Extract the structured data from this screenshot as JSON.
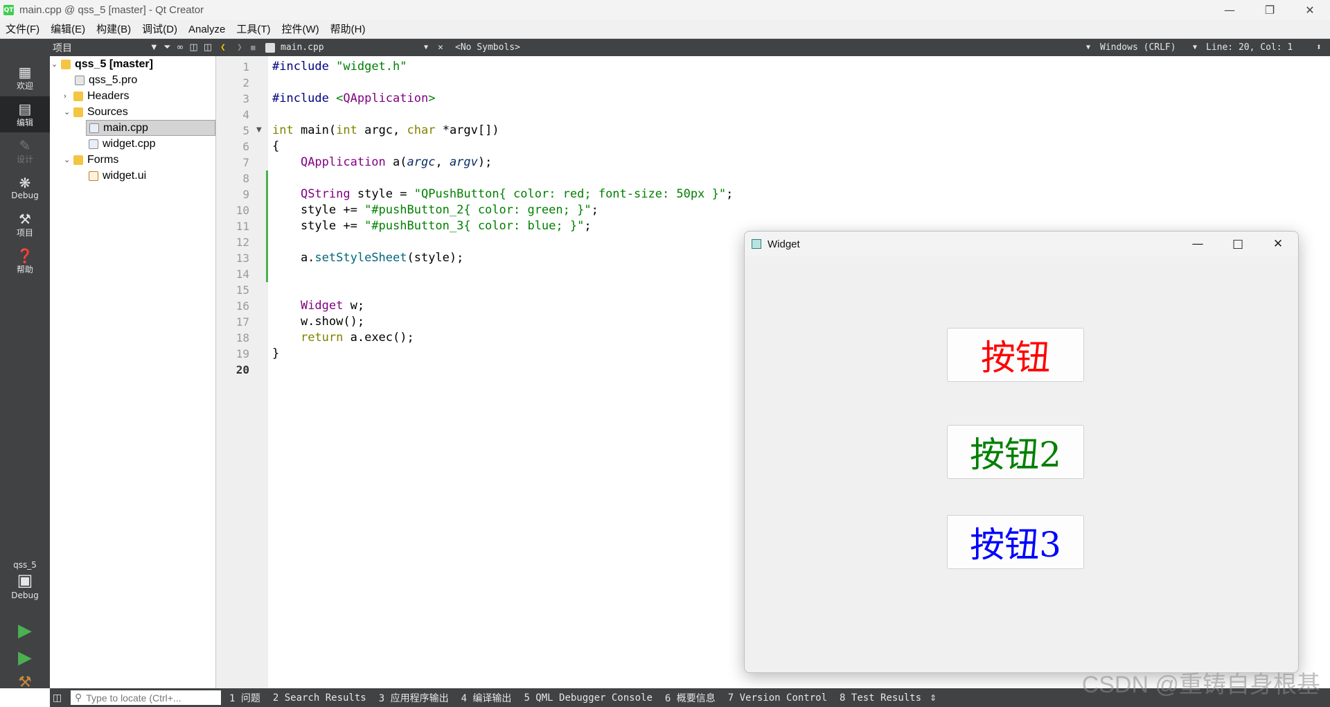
{
  "window": {
    "title": "main.cpp @ qss_5 [master] - Qt Creator",
    "app_icon": "QT"
  },
  "menu": [
    "文件(F)",
    "编辑(E)",
    "构建(B)",
    "调试(D)",
    "Analyze",
    "工具(T)",
    "控件(W)",
    "帮助(H)"
  ],
  "toolbar": {
    "project_label": "项目",
    "file_name": "main.cpp",
    "symbols": "<No Symbols>",
    "line_ending": "Windows (CRLF)",
    "position": "Line: 20, Col: 1"
  },
  "modes": [
    {
      "label": "欢迎",
      "icon": "grid-icon"
    },
    {
      "label": "编辑",
      "icon": "edit-icon",
      "active": true
    },
    {
      "label": "设计",
      "icon": "design-icon",
      "disabled": true
    },
    {
      "label": "Debug",
      "icon": "bug-icon"
    },
    {
      "label": "项目",
      "icon": "wrench-icon"
    },
    {
      "label": "帮助",
      "icon": "help-icon"
    }
  ],
  "kit": {
    "project": "qss_5",
    "config": "Debug"
  },
  "tree": [
    {
      "label": "qss_5 [master]",
      "level": 0,
      "expanded": true,
      "bold": true
    },
    {
      "label": "qss_5.pro",
      "level": 1
    },
    {
      "label": "Headers",
      "level": 1,
      "expanded": false
    },
    {
      "label": "Sources",
      "level": 1,
      "expanded": true
    },
    {
      "label": "main.cpp",
      "level": 2,
      "selected": true
    },
    {
      "label": "widget.cpp",
      "level": 2
    },
    {
      "label": "Forms",
      "level": 1,
      "expanded": true
    },
    {
      "label": "widget.ui",
      "level": 2
    }
  ],
  "code": {
    "current_line": 20,
    "lines": [
      "#include \"widget.h\"",
      "",
      "#include <QApplication>",
      "",
      "int main(int argc, char *argv[])",
      "{",
      "    QApplication a(argc, argv);",
      "",
      "    QString style = \"QPushButton{ color: red; font-size: 50px }\";",
      "    style += \"#pushButton_2{ color: green; }\";",
      "    style += \"#pushButton_3{ color: blue; }\";",
      "",
      "    a.setStyleSheet(style);",
      "",
      "",
      "    Widget w;",
      "    w.show();",
      "    return a.exec();",
      "}",
      ""
    ]
  },
  "widget_window": {
    "title": "Widget",
    "buttons": [
      {
        "label": "按钮",
        "color": "#ff0000"
      },
      {
        "label": "按钮2",
        "color": "#008000"
      },
      {
        "label": "按钮3",
        "color": "#0000ff"
      }
    ]
  },
  "statusbar": {
    "locator_placeholder": "Type to locate (Ctrl+...",
    "panes": [
      "1 问题",
      "2 Search Results",
      "3 应用程序输出",
      "4 编译输出",
      "5 QML Debugger Console",
      "6 概要信息",
      "7 Version Control",
      "8 Test Results"
    ]
  },
  "watermark": "CSDN @重铸自身根基"
}
